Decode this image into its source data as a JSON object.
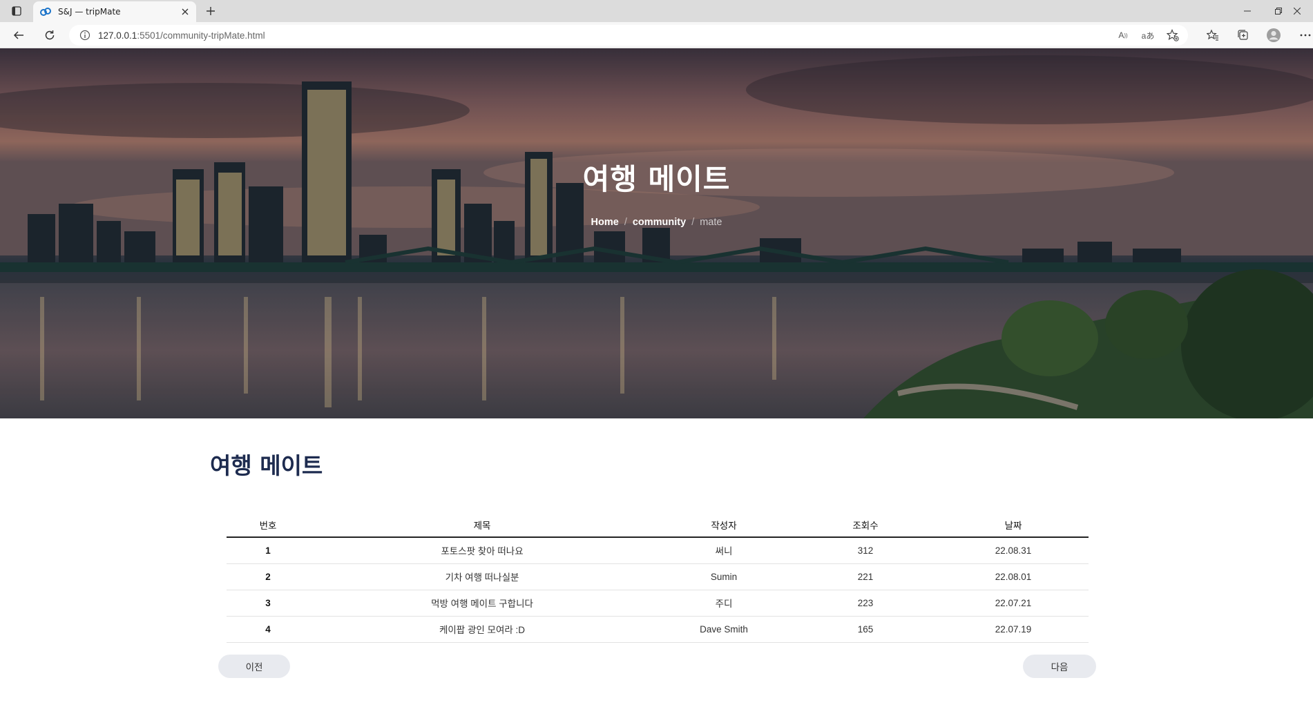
{
  "browser": {
    "tab_title": "S&J — tripMate",
    "url_host": "127.0.0.1",
    "url_rest": ":5501/community-tripMate.html",
    "icons": [
      "tab-actions-icon",
      "tripmate-favicon",
      "close-icon",
      "plus-icon",
      "back-icon",
      "reload-icon",
      "info-icon",
      "read-aloud-icon",
      "translate-icon",
      "favorite-add-icon",
      "favorites-icon",
      "collections-icon",
      "profile-icon",
      "more-icon",
      "minimize-icon",
      "restore-icon",
      "close-window-icon"
    ]
  },
  "hero": {
    "title": "여행 메이트",
    "breadcrumb": {
      "home": "Home",
      "community": "community",
      "current": "mate",
      "separator": "/"
    }
  },
  "main": {
    "heading": "여행 메이트",
    "table": {
      "headers": [
        "번호",
        "제목",
        "작성자",
        "조회수",
        "날짜"
      ],
      "rows": [
        {
          "no": "1",
          "title": "포토스팟 찾아 떠나요",
          "author": "써니",
          "views": "312",
          "date": "22.08.31"
        },
        {
          "no": "2",
          "title": "기차 여행 떠나실분",
          "author": "Sumin",
          "views": "221",
          "date": "22.08.01"
        },
        {
          "no": "3",
          "title": "먹방 여행 메이트 구합니다",
          "author": "주디",
          "views": "223",
          "date": "22.07.21"
        },
        {
          "no": "4",
          "title": "케이팝 광인 모여라 :D",
          "author": "Dave Smith",
          "views": "165",
          "date": "22.07.19"
        }
      ]
    },
    "pager": {
      "prev_label": "이전",
      "next_label": "다음"
    }
  },
  "colors": {
    "heading": "#1d2b4f",
    "pager_bg": "#e8eaef",
    "favicon": "#1a73c9"
  }
}
